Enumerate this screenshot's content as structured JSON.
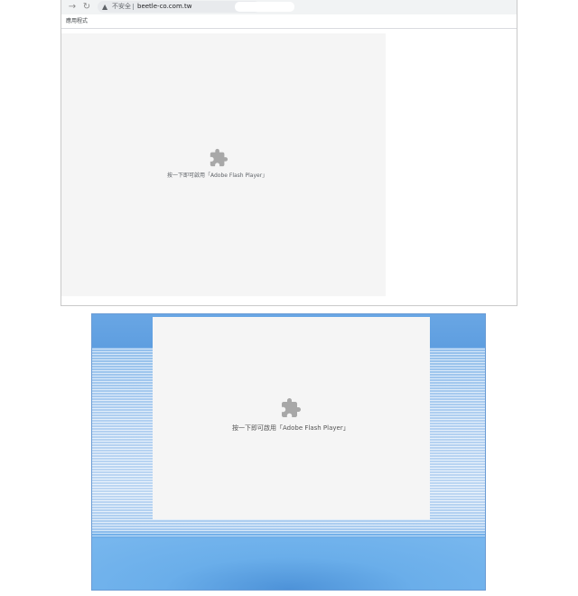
{
  "browser": {
    "nav": {
      "forward_icon": "arrow-right-icon",
      "reload_icon": "reload-icon"
    },
    "omnibox": {
      "security_icon": "warning-triangle-icon",
      "security_label": "不安全",
      "url": "beetle-co.com.tw"
    },
    "bookmarks": {
      "apps_label": "應用程式"
    },
    "plugin": {
      "icon": "puzzle-piece-icon",
      "message": "按一下即可啟用「Adobe Flash Player」"
    }
  },
  "page": {
    "plugin": {
      "icon": "puzzle-piece-icon",
      "message": "按一下即可啟用「Adobe Flash Player」"
    }
  },
  "colors": {
    "plugin_bg": "#f5f5f5",
    "puzzle_gray": "#a8a8a8",
    "banner_blue": "#5e9ee0"
  }
}
